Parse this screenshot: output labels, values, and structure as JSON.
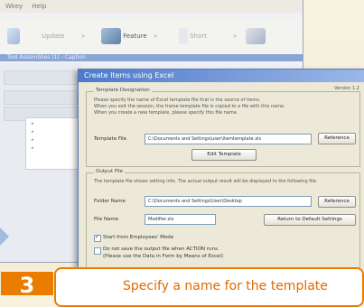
{
  "background_window": {
    "menu": [
      "Wkey",
      "Help"
    ],
    "toolbar": [
      "Update",
      "Feature",
      "Short"
    ],
    "subtitle": "Tool Assemblies (1) - Caption"
  },
  "dialog": {
    "title": "Create Items using Excel",
    "version": "Version 1.2",
    "template_group": {
      "label": "Template Designation",
      "description": [
        "Please specify the name of Excel template file that is the source of items.",
        "When you exit the session, the frame template file is copied to a file with this name.",
        "When you create a new template, please specify this file name."
      ],
      "template_file_label": "Template File",
      "template_file_value": "C:\\Documents and Settings\\user\\itemtemplate.xls",
      "reference_button": "Reference",
      "edit_button": "Edit Template"
    },
    "output_group": {
      "label": "Output File",
      "description": "The template file shows setting info. The actual output result will be displayed to the following file.",
      "folder_label": "Folder Name",
      "folder_value": "C:\\Documents and Settings\\User\\Desktop",
      "reference_button": "Reference",
      "file_label": "File Name",
      "file_value": "Modifier.xls",
      "reset_button": "Return to Default Settings",
      "check1": "Start from Employees' Mode",
      "check2a": "Do not save the output file when ACTION runs.",
      "check2b": "(Please use the Data in Form by Means of Excel)"
    }
  },
  "callout": {
    "step": "3",
    "text": "Specify a name for the template"
  },
  "colors": {
    "accent": "#ea7d00",
    "titlebar": "#4f79c8"
  }
}
